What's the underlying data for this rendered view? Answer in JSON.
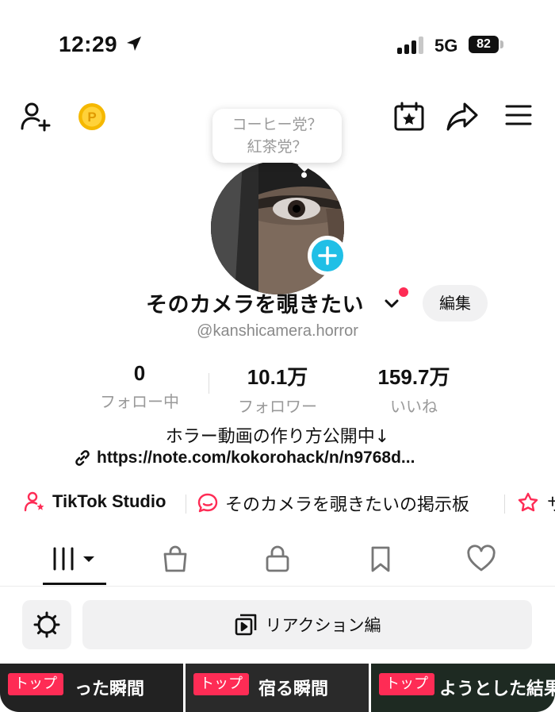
{
  "status": {
    "time": "12:29",
    "network": "5G",
    "battery": "82"
  },
  "tooltip": {
    "line1": "コーヒー党？",
    "line2": "紅茶党？"
  },
  "profile": {
    "display_name": "そのカメラを覗きたい",
    "edit_label": "編集",
    "handle": "@kanshicamera.horror"
  },
  "stats": [
    {
      "value": "0",
      "label": "フォロー中"
    },
    {
      "value": "10.1万",
      "label": "フォロワー"
    },
    {
      "value": "159.7万",
      "label": "いいね"
    }
  ],
  "bio": {
    "text": "ホラー動画の作り方公開中↓",
    "link": "https://note.com/kokorohack/n/n9768d..."
  },
  "quick_links": [
    {
      "label": "TikTok Studio",
      "icon": "person-star-icon"
    },
    {
      "label": "そのカメラを覗きたいの掲示板",
      "icon": "chat-bubble-icon"
    },
    {
      "label": "サ",
      "icon": "puzzle-star-icon"
    }
  ],
  "tabs": [
    {
      "name": "videos",
      "icon": "grid-icon"
    },
    {
      "name": "shop",
      "icon": "shopping-bag-icon"
    },
    {
      "name": "private",
      "icon": "lock-icon"
    },
    {
      "name": "saved",
      "icon": "bookmark-icon"
    },
    {
      "name": "liked",
      "icon": "heart-icon"
    }
  ],
  "filter": {
    "reaction_label": "リアクション編"
  },
  "videos": [
    {
      "badge": "トップ",
      "caption": "った瞬間"
    },
    {
      "badge": "トップ",
      "caption": "宿る瞬間"
    },
    {
      "badge": "トップ",
      "caption": "ようとした結果"
    }
  ],
  "colors": {
    "accent": "#fe2c55",
    "avatar_add": "#20bfe6",
    "chip_bg": "#f1f1f2"
  }
}
